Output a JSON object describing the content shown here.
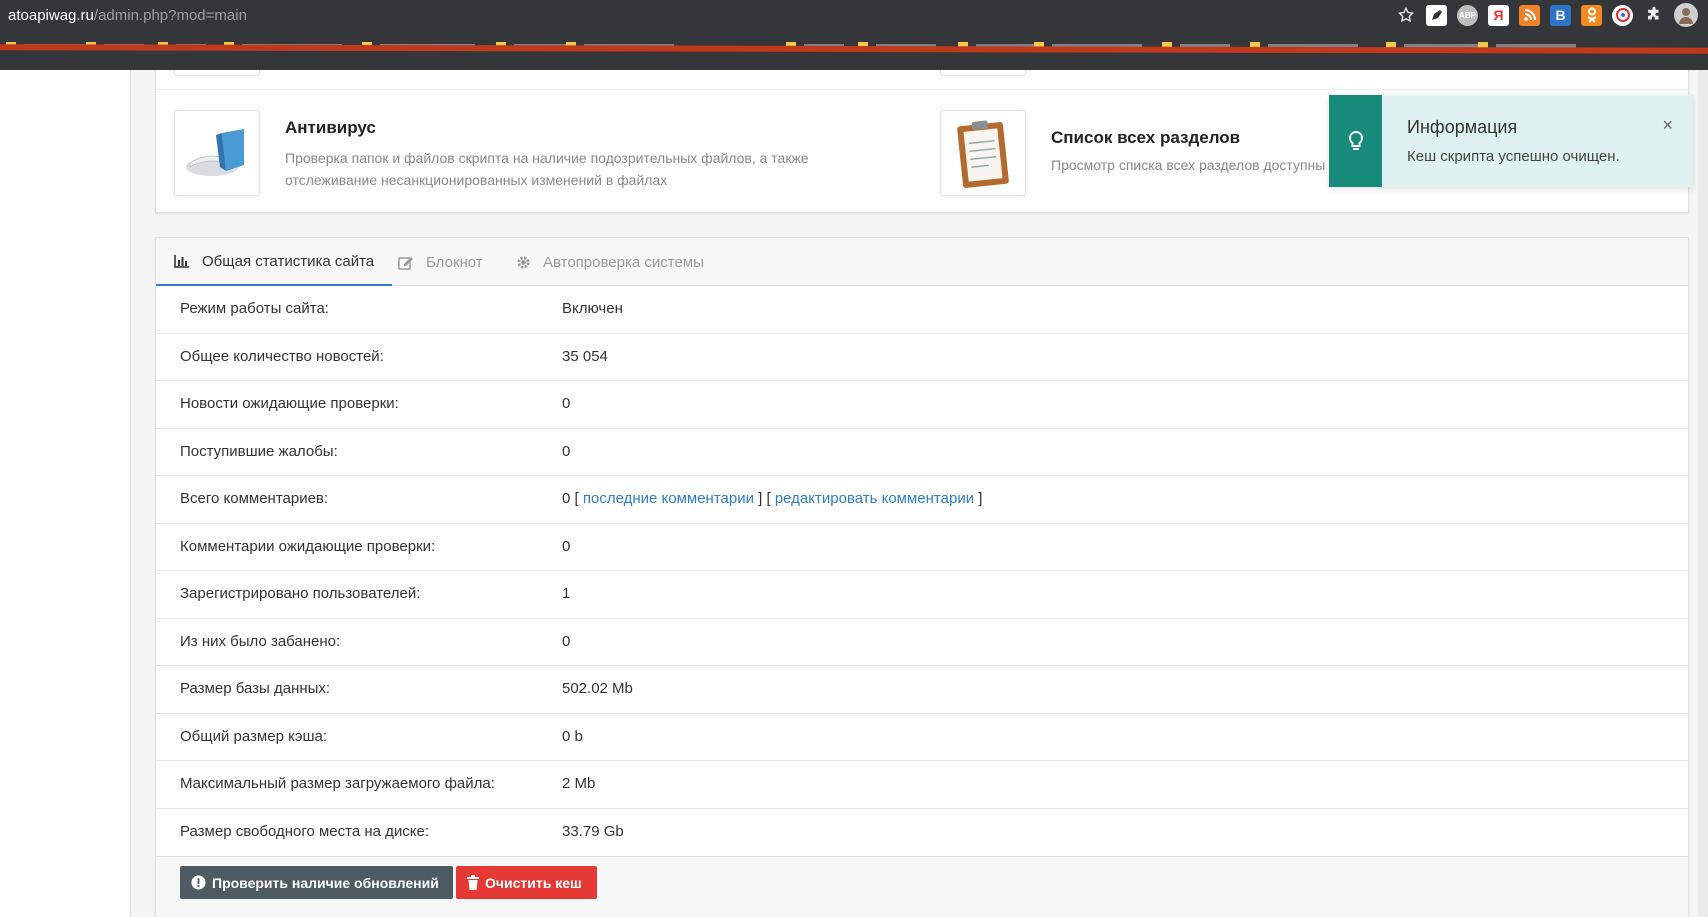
{
  "browser": {
    "url_host": "atoapiwag.ru",
    "url_path": "/admin.php?mod=main",
    "extensions": [
      {
        "icon": "star-icon",
        "color": "#35363a"
      },
      {
        "icon": "pen-extension-icon",
        "color": "#ffffff"
      },
      {
        "icon": "abp-icon",
        "label": "ABP",
        "color": "#bdbdbd"
      },
      {
        "icon": "yandex-icon",
        "label": "Я",
        "color": "#ffffff"
      },
      {
        "icon": "rss-icon",
        "color": "#f0822a"
      },
      {
        "icon": "vk-icon",
        "label": "B",
        "color": "#2f73c9"
      },
      {
        "icon": "ok-icon",
        "color": "#f28a1e"
      },
      {
        "icon": "target-extension-icon",
        "color": "#ffffff"
      },
      {
        "icon": "puzzle-icon",
        "color": "#35363a"
      },
      {
        "icon": "avatar-icon",
        "color": "#cfcfcf"
      }
    ]
  },
  "modules": [
    {
      "title": "Антивирус",
      "desc_line1": "Проверка папок и файлов скрипта на наличие подозрительных файлов, а также",
      "desc_line2": "отслеживание несанкционированных изменений в файлах",
      "icon": "antivirus-icon"
    },
    {
      "title": "Список всех разделов",
      "desc_line1": "Просмотр списка всех разделов доступны",
      "desc_line2": "",
      "icon": "clipboard-icon"
    }
  ],
  "toast": {
    "title": "Информация",
    "text": "Кеш скрипта успешно очищен.",
    "close": "×",
    "accent": "#178a7b"
  },
  "tabs": [
    {
      "label": "Общая статистика сайта",
      "icon": "bar-chart-icon",
      "active": true
    },
    {
      "label": "Блокнот",
      "icon": "edit-icon",
      "active": false
    },
    {
      "label": "Автопроверка системы",
      "icon": "gear-icon",
      "active": false
    }
  ],
  "stats": [
    {
      "label": "Режим работы сайта:",
      "value": "Включен"
    },
    {
      "label": "Общее количество новостей:",
      "value": "35 054"
    },
    {
      "label": "Новости ожидающие проверки:",
      "value": "0"
    },
    {
      "label": "Поступившие жалобы:",
      "value": "0"
    },
    {
      "label": "Всего комментариев:",
      "value": "0",
      "bracket_open": " [ ",
      "link1": "последние комментарии",
      "bracket_mid": " ] [ ",
      "link2": "редактировать комментарии",
      "bracket_close": " ]"
    },
    {
      "label": "Комментарии ожидающие проверки:",
      "value": "0"
    },
    {
      "label": "Зарегистрировано пользователей:",
      "value": "1"
    },
    {
      "label": "Из них было забанено:",
      "value": "0",
      "value_color": "#d9432f"
    },
    {
      "label": "Размер базы данных:",
      "value": "502.02 Mb"
    },
    {
      "label": "Общий размер кэша:",
      "value": "0 b"
    },
    {
      "label": "Максимальный размер загружаемого файла:",
      "value": "2 Mb"
    },
    {
      "label": "Размер свободного места на диске:",
      "value": "33.79 Gb"
    }
  ],
  "buttons": {
    "check_updates": "Проверить наличие обновлений",
    "clear_cache": "Очистить кеш"
  }
}
